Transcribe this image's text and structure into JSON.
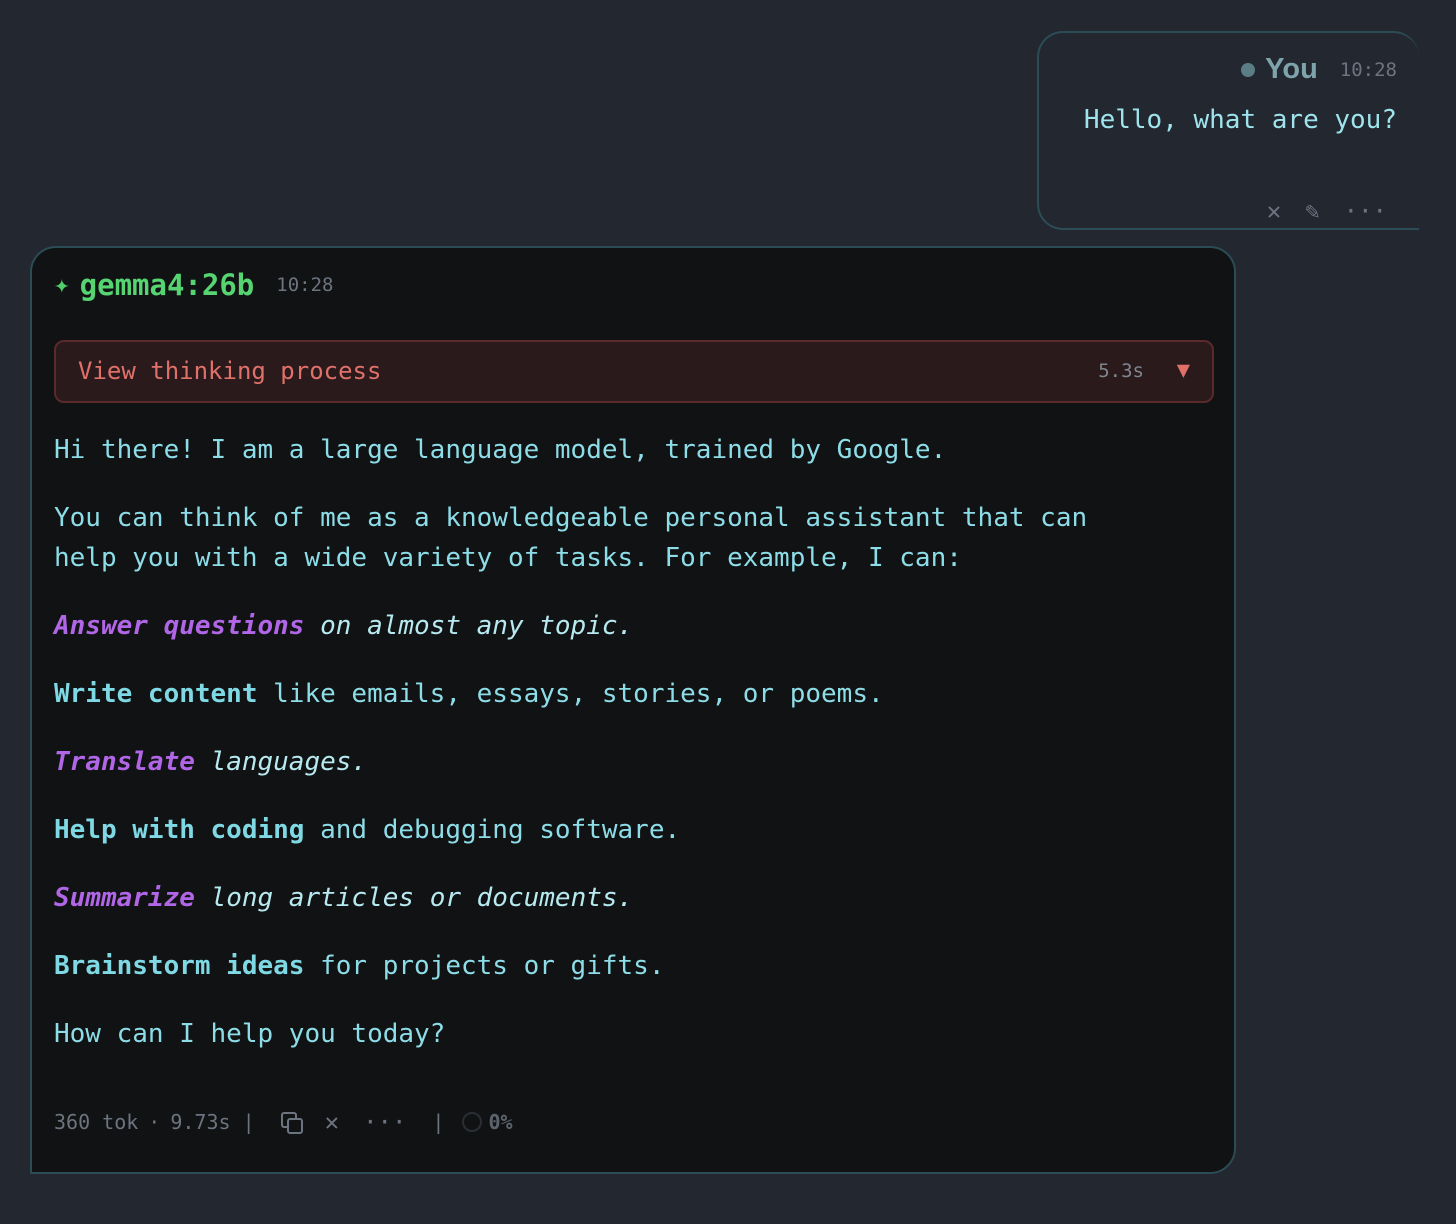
{
  "user_message": {
    "author": "You",
    "time": "10:28",
    "text": "Hello, what are you?",
    "actions": {
      "delete": "✕",
      "edit": "✎",
      "more": "···"
    }
  },
  "assistant_message": {
    "spark": "✦",
    "model": "gemma4:26b",
    "time": "10:28",
    "thinking": {
      "label": "View thinking process",
      "duration": "5.3s",
      "caret": "▼"
    },
    "body": {
      "intro": "Hi there! I am a large language model, trained by Google.",
      "para2_line1": "You can think of me as a knowledgeable personal assistant that can",
      "para2_line2": "help you with a wide variety of tasks. For example, I can:",
      "items": [
        {
          "lead": "Answer questions",
          "rest": " on almost any topic."
        },
        {
          "lead": "Write content",
          "rest": " like emails, essays, stories, or poems."
        },
        {
          "lead": "Translate",
          "rest": " languages."
        },
        {
          "lead": "Help with coding",
          "rest": " and debugging software."
        },
        {
          "lead": "Summarize",
          "rest": " long articles or documents."
        },
        {
          "lead": "Brainstorm ideas",
          "rest": " for projects or gifts."
        }
      ],
      "closing": "How can I help you today?"
    },
    "footer": {
      "tokens": "360 tok",
      "dot": "·",
      "elapsed": "9.73s",
      "separator": "|",
      "delete": "✕",
      "more": "···",
      "percent": "0%"
    }
  }
}
